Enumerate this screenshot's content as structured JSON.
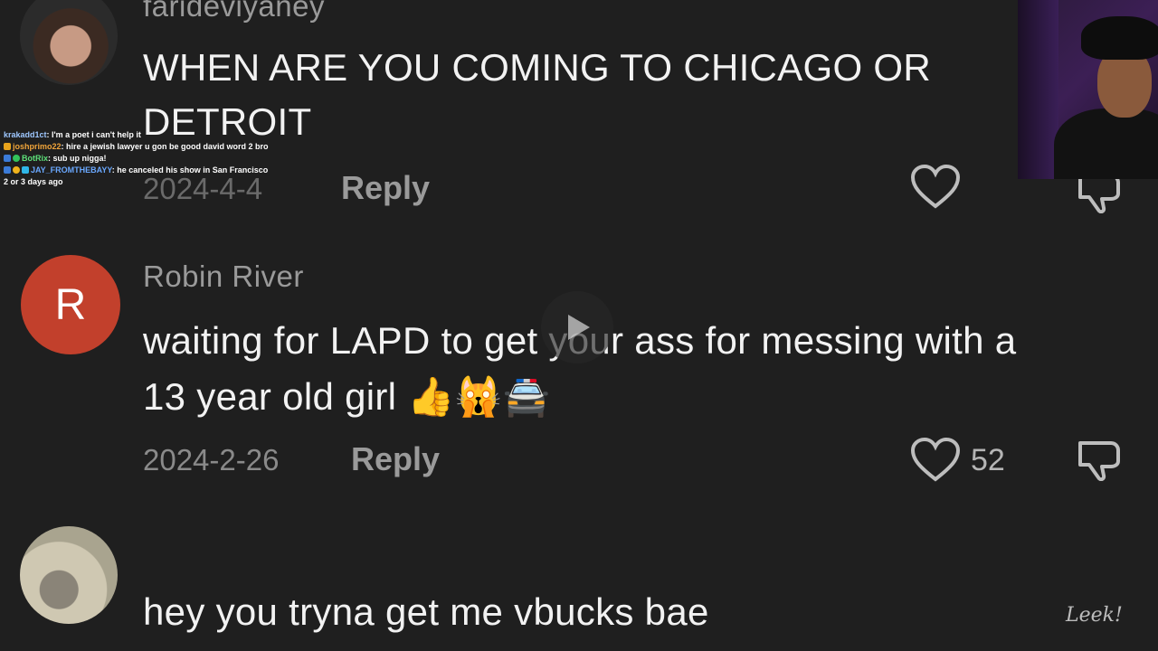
{
  "comments": [
    {
      "username": "farideviyaney",
      "text_line1": "WHEN ARE YOU COMING TO CHICAGO OR",
      "text_line2": "DETROIT",
      "date": "2024-4-4",
      "reply_label": "Reply",
      "like_count": "",
      "avatar_icon": "profile-photo-icon"
    },
    {
      "username": "Robin River",
      "avatar_letter": "R",
      "text_line1": "waiting for LAPD to get your ass for messing with a",
      "text_line2": "13 year old girl 👍🙀🚔",
      "date": "2024-2-26",
      "reply_label": "Reply",
      "like_count": "52"
    },
    {
      "username": "",
      "text_line1": "hey you tryna get me vbucks bae",
      "avatar_icon": "profile-photo-icon"
    }
  ],
  "chat": [
    {
      "user": "krakadd1ct",
      "message": "I'm a poet i can't help it",
      "user_color": "#9ec7ff"
    },
    {
      "user": "joshprimo22",
      "message": "hire a jewish lawyer u gon be good david word 2 bro",
      "user_color": "#f0a43a"
    },
    {
      "user": "BotRix",
      "message": "sub up nigga!",
      "user_color": "#5ee07a"
    },
    {
      "user": "JAY_FROMTHEBAYY",
      "message": "he canceled his show in San Francisco",
      "user_color": "#6aa8ff"
    },
    {
      "user": "",
      "message": "2 or 3 days ago",
      "user_color": "#ffffff"
    }
  ],
  "watermark": "Leek!",
  "colors": {
    "background": "#1f1f1f",
    "avatar_letter_bg": "#c2402c",
    "text_primary": "#f2f2f2",
    "text_secondary": "#9a9a9a"
  }
}
